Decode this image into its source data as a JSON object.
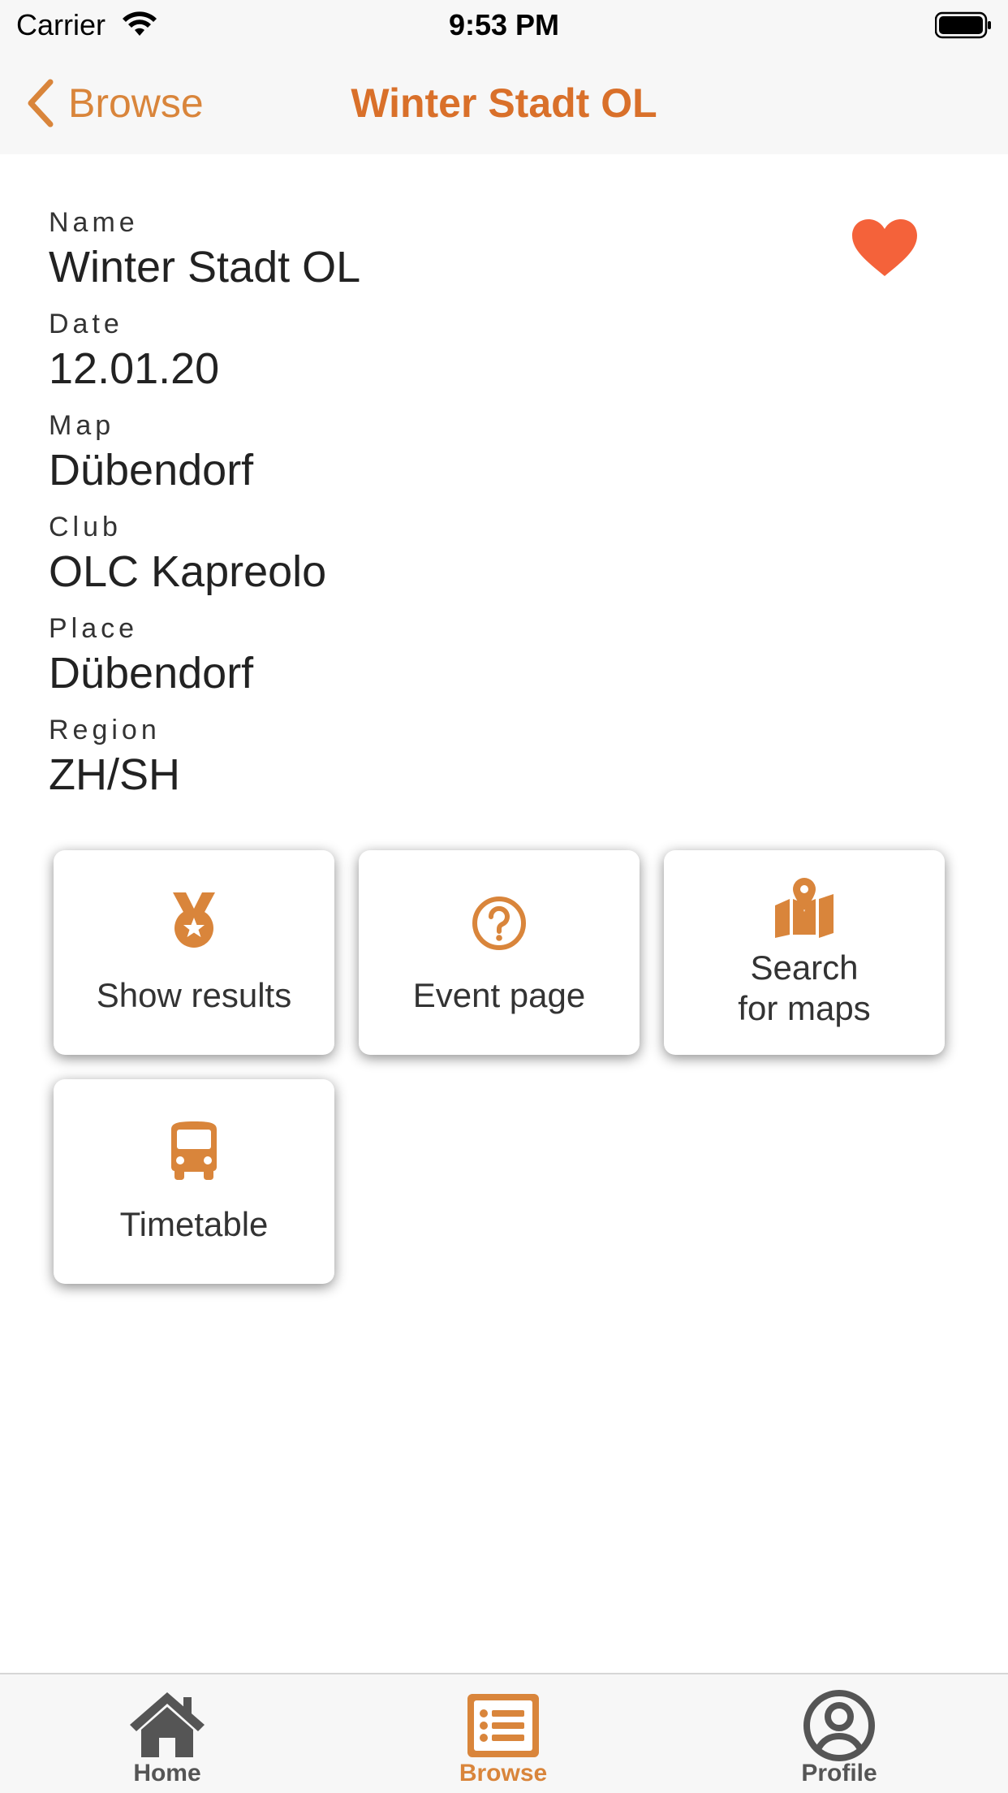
{
  "status_bar": {
    "carrier": "Carrier",
    "time": "9:53 PM"
  },
  "nav": {
    "back_label": "Browse",
    "title": "Winter Stadt OL"
  },
  "details": {
    "name_label": "Name",
    "name_value": "Winter Stadt OL",
    "date_label": "Date",
    "date_value": "12.01.20",
    "map_label": "Map",
    "map_value": "Dübendorf",
    "club_label": "Club",
    "club_value": "OLC Kapreolo",
    "place_label": "Place",
    "place_value": "Dübendorf",
    "region_label": "Region",
    "region_value": "ZH/SH"
  },
  "favorite": {
    "icon": "heart-icon",
    "state": "favorited",
    "color": "#f4623a"
  },
  "actions": {
    "show_results": {
      "label": "Show results",
      "icon": "medal-icon"
    },
    "event_page": {
      "label": "Event page",
      "icon": "question-circle-icon"
    },
    "search_maps": {
      "line1": "Search",
      "line2": "for maps",
      "icon": "map-marker-icon"
    },
    "timetable": {
      "label": "Timetable",
      "icon": "bus-icon"
    }
  },
  "tab_bar": {
    "home": {
      "label": "Home",
      "icon": "home-icon"
    },
    "browse": {
      "label": "Browse",
      "icon": "list-icon",
      "active": true
    },
    "profile": {
      "label": "Profile",
      "icon": "user-circle-icon"
    }
  },
  "colors": {
    "accent": "#d9853b",
    "title": "#d9702a",
    "inactive": "#555555",
    "heart": "#f4623a"
  }
}
